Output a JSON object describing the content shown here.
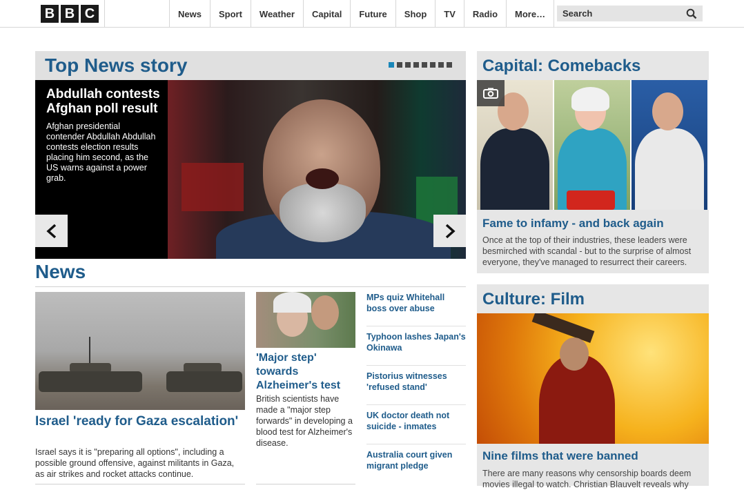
{
  "header": {
    "logo": [
      "B",
      "B",
      "C"
    ],
    "nav": [
      "News",
      "Sport",
      "Weather",
      "Capital",
      "Future",
      "Shop",
      "TV",
      "Radio",
      "More…"
    ],
    "search_placeholder": "Search"
  },
  "top_story": {
    "heading": "Top News story",
    "active_slide": 1,
    "slide_count": 8,
    "title": "Abdullah contests Afghan poll result",
    "summary": "Afghan presidential contender Abdullah Abdullah contests election results placing him second, as the US warns against a power grab."
  },
  "news": {
    "heading": "News",
    "lead": {
      "title": "Israel 'ready for Gaza escalation'",
      "summary": "Israel says it is \"preparing all options\", including a possible ground offensive, against militants in Gaza, as air strikes and rocket attacks continue."
    },
    "second": {
      "title": "'Major step' towards Alzheimer's test",
      "summary": "British scientists have made a \"major step forwards\" in developing a blood test for Alzheimer's disease."
    },
    "list": [
      "MPs quiz Whitehall boss over abuse",
      "Typhoon lashes Japan's Okinawa",
      "Pistorius witnesses 'refused stand'",
      "UK doctor death not suicide - inmates",
      "Australia court given migrant pledge"
    ]
  },
  "capital": {
    "heading": "Capital: Comebacks",
    "title": "Fame to infamy - and back again",
    "summary": "Once at the top of their industries, these leaders were besmirched with scandal - but to the surprise of almost everyone, they've managed to resurrect their careers."
  },
  "culture": {
    "heading": "Culture: Film",
    "title": "Nine films that were banned",
    "summary": "There are many reasons why censorship boards deem movies illegal to watch. Christian Blauvelt reveals why"
  }
}
